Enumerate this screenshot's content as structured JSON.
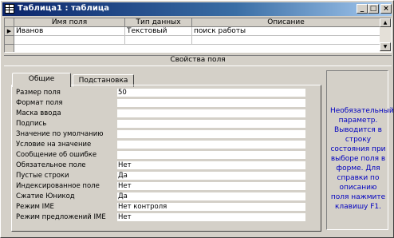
{
  "window": {
    "title": "Таблица1 : таблица"
  },
  "titlebar_buttons": {
    "minimize": "_",
    "maximize": "□",
    "close": "×"
  },
  "grid": {
    "columns": [
      "Имя поля",
      "Тип данных",
      "Описание"
    ],
    "rows": [
      {
        "selector": "▶",
        "name": "Иванов",
        "type": "Текстовый",
        "description": "поиск работы"
      }
    ]
  },
  "section_label": "Свойства поля",
  "tabs": [
    "Общие",
    "Подстановка"
  ],
  "properties": [
    {
      "label": "Размер поля",
      "value": "50"
    },
    {
      "label": "Формат поля",
      "value": ""
    },
    {
      "label": "Маска ввода",
      "value": ""
    },
    {
      "label": "Подпись",
      "value": ""
    },
    {
      "label": "Значение по умолчанию",
      "value": ""
    },
    {
      "label": "Условие на значение",
      "value": ""
    },
    {
      "label": "Сообщение об ошибке",
      "value": ""
    },
    {
      "label": "Обязательное поле",
      "value": "Нет"
    },
    {
      "label": "Пустые строки",
      "value": "Да"
    },
    {
      "label": "Индексированное поле",
      "value": "Нет"
    },
    {
      "label": "Сжатие Юникод",
      "value": "Да"
    },
    {
      "label": "Режим IME",
      "value": "Нет контроля"
    },
    {
      "label": "Режим предложений IME",
      "value": "Нет"
    }
  ],
  "help": "Необязательный параметр. Выводится в строку состояния при выборе поля в форме. Для справки по описанию поля нажмите клавишу F1."
}
